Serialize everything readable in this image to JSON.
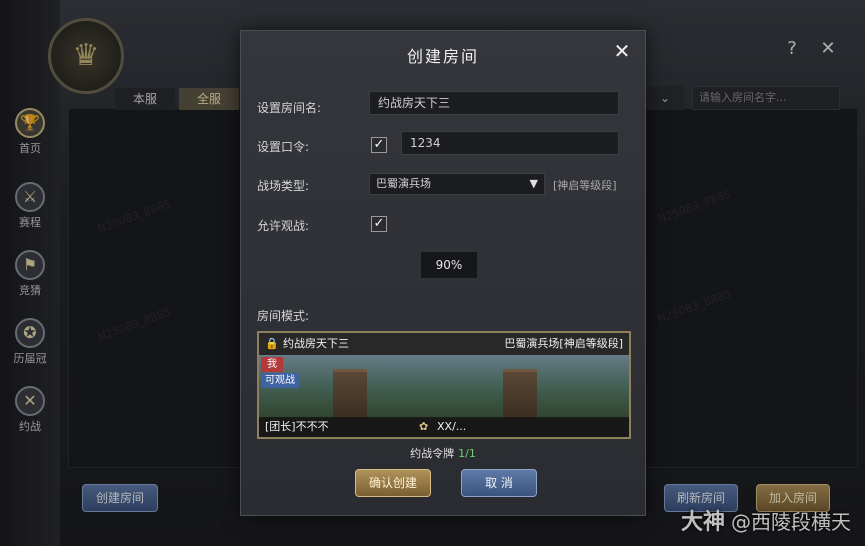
{
  "app": {
    "tabs": [
      "本服",
      "全服"
    ],
    "active_tab": 1,
    "search_placeholder": "请输入房间名字...",
    "help_label": "?",
    "close_label": "✕",
    "select_chevron": "⌄",
    "watermark": "N25083_8885",
    "rail": [
      {
        "label": "首页",
        "icon": "trophy-icon",
        "glyph": "🏆"
      },
      {
        "label": "赛程",
        "icon": "sword-icon",
        "glyph": "⚔"
      },
      {
        "label": "竞猜",
        "icon": "guess-icon",
        "glyph": "⚑"
      },
      {
        "label": "历届冠",
        "icon": "medal-icon",
        "glyph": "✪"
      },
      {
        "label": "约战",
        "icon": "crossed-swords-icon",
        "glyph": "✕"
      }
    ],
    "buttons": {
      "create_room": "创建房间",
      "refresh_room": "刷新房间",
      "join_room": "加入房间"
    },
    "brand": {
      "name": "大神",
      "handle": "@西陵段横天"
    }
  },
  "modal": {
    "title": "创建房间",
    "close_label": "✕",
    "room_name_label": "设置房间名:",
    "room_name_value": "约战房天下三",
    "password_label": "设置口令:",
    "password_checked": true,
    "password_value": "1234",
    "battlefield_label": "战场类型:",
    "battlefield_value": "巴蜀演兵场",
    "battlefield_tier": "[神启等级段]",
    "allow_watch_label": "允许观战:",
    "allow_watch_checked": true,
    "percent": "90%",
    "room_mode_label": "房间模式:",
    "card": {
      "room_name": "约战房天下三",
      "field": "巴蜀演兵场[神启等级段]",
      "tag_me": "我",
      "tag_watch": "可观战",
      "leader": "[团长]不不不",
      "score": "XX/..."
    },
    "token_label": "约战令牌",
    "token_count": "1/1",
    "confirm_label": "确认创建",
    "cancel_label": "取 消"
  }
}
